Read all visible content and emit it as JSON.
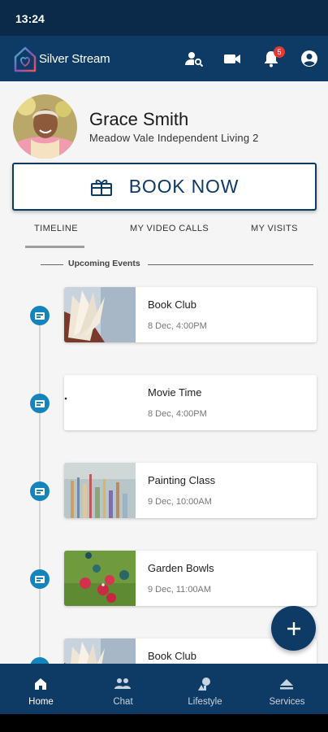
{
  "status_bar": {
    "time": "13:24"
  },
  "app_bar": {
    "brand": "Silver Stream",
    "icons": [
      "find-person-icon",
      "video-camera-icon",
      "bell-icon",
      "account-icon"
    ],
    "notification_count": "5"
  },
  "profile": {
    "name": "Grace Smith",
    "subtitle": "Meadow Vale Independent Living 2"
  },
  "book_now": {
    "label": "BOOK NOW",
    "icon": "gift-icon"
  },
  "tabs": [
    {
      "label": "TIMELINE",
      "active": true
    },
    {
      "label": "MY VIDEO CALLS",
      "active": false
    },
    {
      "label": "MY VISITS",
      "active": false
    }
  ],
  "section": {
    "title": "Upcoming Events"
  },
  "events": [
    {
      "title": "Book Club",
      "date": "8 Dec, 4:00PM",
      "thumb": "book"
    },
    {
      "title": "Movie Time",
      "date": "8 Dec, 4:00PM",
      "thumb": "blank"
    },
    {
      "title": "Painting Class",
      "date": "9 Dec, 10:00AM",
      "thumb": "brushes"
    },
    {
      "title": "Garden Bowls",
      "date": "9 Dec, 11:00AM",
      "thumb": "bowls"
    },
    {
      "title": "Book Club",
      "date": "",
      "thumb": "book"
    }
  ],
  "fab": {
    "icon": "plus-icon"
  },
  "bottom_nav": [
    {
      "label": "Home",
      "icon": "home-icon",
      "active": true
    },
    {
      "label": "Chat",
      "icon": "people-icon",
      "active": false
    },
    {
      "label": "Lifestyle",
      "icon": "lifestyle-icon",
      "active": false
    },
    {
      "label": "Services",
      "icon": "eject-icon",
      "active": false
    }
  ],
  "colors": {
    "primary": "#0e3a66",
    "status_bar": "#0b2a4a",
    "accent_dot": "#1584bd",
    "badge": "#e53935"
  }
}
